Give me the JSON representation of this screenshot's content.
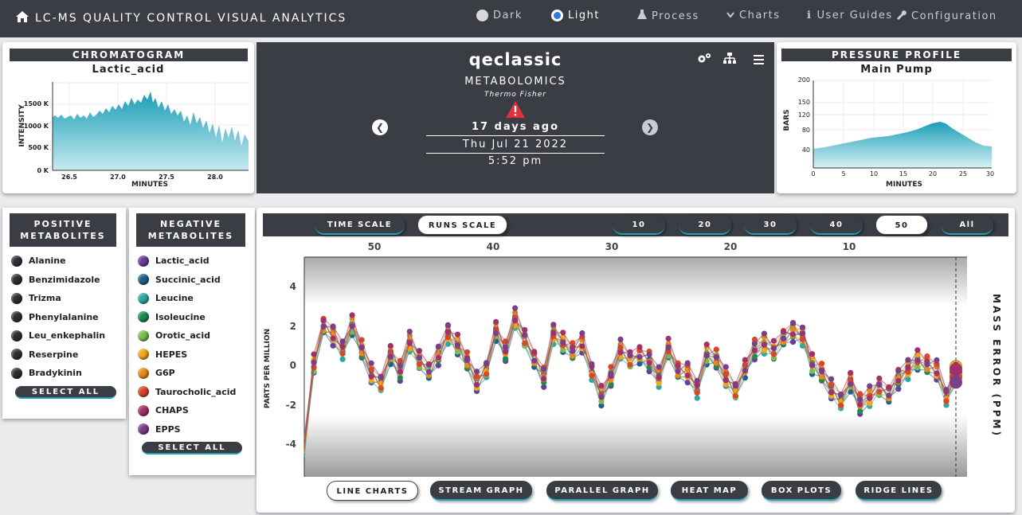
{
  "app": {
    "title": "LC-MS QUALITY CONTROL VISUAL ANALYTICS"
  },
  "nav": {
    "dark": "Dark",
    "light": "Light",
    "process": "Process",
    "charts": "Charts",
    "guides": "User Guides",
    "config": "Configuration"
  },
  "chromatogram": {
    "title": "CHROMATOGRAM",
    "subtitle": "Lactic_acid",
    "ylabel": "INTENSITY",
    "xlabel": "MINUTES",
    "yticks": [
      "0 K",
      "500 K",
      "1000 K",
      "1500 K"
    ],
    "xticks": [
      "26.5",
      "27.0",
      "27.5",
      "28.0"
    ]
  },
  "run": {
    "name": "qeclassic",
    "type": "METABOLOMICS",
    "vendor": "Thermo Fisher",
    "ago": "17 days ago",
    "date": "Thu Jul 21 2022",
    "time": "5:52 pm"
  },
  "pressure": {
    "title": "PRESSURE PROFILE",
    "subtitle": "Main Pump",
    "ylabel": "BARS",
    "xlabel": "MINUTES",
    "yticks": [
      "40",
      "80",
      "120",
      "150",
      "200"
    ],
    "xticks": [
      "0",
      "5",
      "10",
      "15",
      "20",
      "25",
      "30"
    ]
  },
  "positive": {
    "title": "POSITIVE METABOLITES",
    "items": [
      "Alanine",
      "Benzimidazole",
      "Trizma",
      "Phenylalanine",
      "Leu_enkephalin",
      "Reserpine",
      "Bradykinin"
    ],
    "select_all": "SELECT ALL"
  },
  "negative": {
    "title": "NEGATIVE METABOLITES",
    "items": [
      {
        "label": "Lactic_acid",
        "color": "#6a3d9a"
      },
      {
        "label": "Succinic_acid",
        "color": "#1f5f8b"
      },
      {
        "label": "Leucine",
        "color": "#2ea7a3"
      },
      {
        "label": "Isoleucine",
        "color": "#1e8a4c"
      },
      {
        "label": "Orotic_acid",
        "color": "#7cbd4a"
      },
      {
        "label": "HEPES",
        "color": "#f0a818"
      },
      {
        "label": "G6P",
        "color": "#e88a1a"
      },
      {
        "label": "Taurocholic_acid",
        "color": "#d9472b"
      },
      {
        "label": "CHAPS",
        "color": "#a2306a"
      },
      {
        "label": "EPPS",
        "color": "#7a3f8a"
      }
    ],
    "select_all": "SELECT ALL"
  },
  "controls": {
    "time_scale": "TIME SCALE",
    "runs_scale": "RUNS SCALE",
    "ranges": [
      "10",
      "20",
      "30",
      "40",
      "50",
      "All"
    ]
  },
  "main_chart": {
    "ylabel": "PARTS PER MILLION",
    "right_label": "MASS ERROR (PPM)",
    "yticks": [
      "4",
      "2",
      "0",
      "-2",
      "-4"
    ],
    "xticks": [
      "50",
      "40",
      "30",
      "20",
      "10"
    ]
  },
  "chart_tabs": [
    "LINE CHARTS",
    "STREAM GRAPH",
    "PARALLEL GRAPH",
    "HEAT MAP",
    "BOX PLOTS",
    "RIDGE LINES"
  ],
  "colors": {
    "accent": "#1fa1b5",
    "dark": "#3a3d44",
    "alert": "#e0303a"
  }
}
